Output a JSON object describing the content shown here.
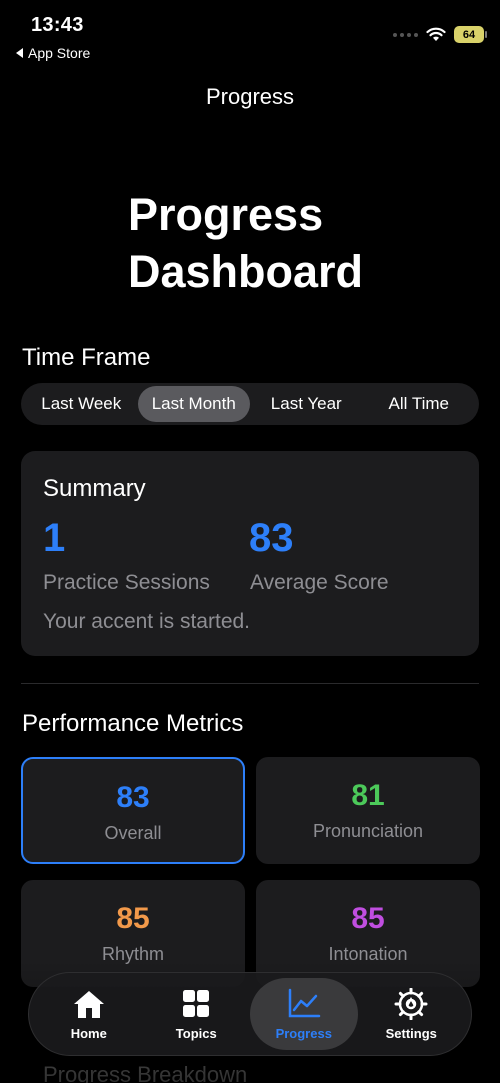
{
  "status_bar": {
    "time": "13:43",
    "back_label": "App Store",
    "battery": "64"
  },
  "nav": {
    "title": "Progress"
  },
  "header": {
    "title_line1": "Progress",
    "title_line2": "Dashboard"
  },
  "time_frame": {
    "title": "Time Frame",
    "options": [
      "Last Week",
      "Last Month",
      "Last Year",
      "All Time"
    ],
    "selected": "Last Month"
  },
  "summary": {
    "title": "Summary",
    "sessions_value": "1",
    "sessions_label": "Practice Sessions",
    "score_value": "83",
    "score_label": "Average Score",
    "note": "Your accent is started.",
    "accent_color": "#2d7ff9"
  },
  "metrics": {
    "title": "Performance Metrics",
    "items": [
      {
        "value": "83",
        "label": "Overall",
        "color": "#2d7ff9"
      },
      {
        "value": "81",
        "label": "Pronunciation",
        "color": "#4cc95a"
      },
      {
        "value": "85",
        "label": "Rhythm",
        "color": "#f2994a"
      },
      {
        "value": "85",
        "label": "Intonation",
        "color": "#c04ee0"
      }
    ]
  },
  "breakdown": {
    "title": "Progress Breakdown"
  },
  "tab_bar": {
    "tabs": [
      {
        "label": "Home",
        "icon": "house-icon"
      },
      {
        "label": "Topics",
        "icon": "grid-icon"
      },
      {
        "label": "Progress",
        "icon": "chart-icon"
      },
      {
        "label": "Settings",
        "icon": "gear-icon"
      }
    ],
    "active": "Progress"
  }
}
